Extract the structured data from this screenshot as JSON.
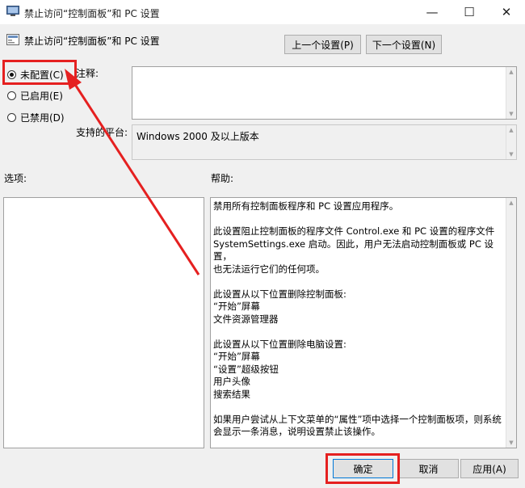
{
  "window": {
    "title": "禁止访问“控制面板”和 PC 设置",
    "minimize": "—",
    "maximize": "☐",
    "close": "✕"
  },
  "header": {
    "policy_title": "禁止访问“控制面板”和 PC 设置",
    "prev_button": "上一个设置(P)",
    "next_button": "下一个设置(N)"
  },
  "options": {
    "not_configured": "未配置(C)",
    "enabled": "已启用(E)",
    "disabled": "已禁用(D)",
    "selected": "not_configured"
  },
  "comment": {
    "label": "注释:",
    "value": ""
  },
  "supported": {
    "label": "支持的平台:",
    "value": "Windows 2000 及以上版本"
  },
  "sections": {
    "options_label": "选项:",
    "help_label": "帮助:"
  },
  "help": {
    "p1": "禁用所有控制面板程序和 PC 设置应用程序。",
    "p2a": "此设置阻止控制面板的程序文件 Control.exe 和 PC 设置的程序文件",
    "p2b": "SystemSettings.exe 启动。因此，用户无法启动控制面板或 PC 设置，",
    "p2c": "也无法运行它们的任何项。",
    "p3": "此设置从以下位置删除控制面板:",
    "p3a": "“开始”屏幕",
    "p3b": "文件资源管理器",
    "p4": "此设置从以下位置删除电脑设置:",
    "p4a": "“开始”屏幕",
    "p4b": "“设置”超级按钮",
    "p4c": "用户头像",
    "p4d": "搜索结果",
    "p5a": "如果用户尝试从上下文菜单的“属性”项中选择一个控制面板项，则系统",
    "p5b": "会显示一条消息，说明设置禁止该操作。"
  },
  "footer": {
    "ok": "确定",
    "cancel": "取消",
    "apply": "应用(A)"
  },
  "colors": {
    "annotation": "#e52020",
    "accent": "#0078d7"
  }
}
